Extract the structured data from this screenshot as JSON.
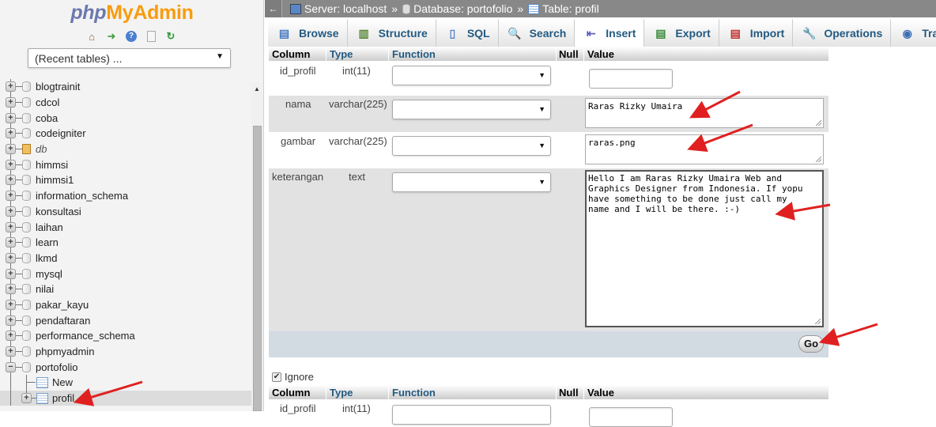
{
  "sidebar": {
    "logo_php": "php",
    "logo_myadmin": "MyAdmin",
    "quick_icons": [
      "home-icon",
      "logout-icon",
      "help-icon",
      "docs-icon",
      "reload-icon"
    ],
    "recent_tables": "(Recent tables) ...",
    "databases": [
      {
        "name": "blogtrainit",
        "icon": "database-icon"
      },
      {
        "name": "cdcol",
        "icon": "database-icon"
      },
      {
        "name": "coba",
        "icon": "database-icon"
      },
      {
        "name": "codeigniter",
        "icon": "database-icon"
      },
      {
        "name": "db",
        "icon": "box-icon"
      },
      {
        "name": "himmsi",
        "icon": "database-icon"
      },
      {
        "name": "himmsi1",
        "icon": "database-icon"
      },
      {
        "name": "information_schema",
        "icon": "database-icon"
      },
      {
        "name": "konsultasi",
        "icon": "database-icon"
      },
      {
        "name": "laihan",
        "icon": "database-icon"
      },
      {
        "name": "learn",
        "icon": "database-icon"
      },
      {
        "name": "lkmd",
        "icon": "database-icon"
      },
      {
        "name": "mysql",
        "icon": "database-icon"
      },
      {
        "name": "nilai",
        "icon": "database-icon"
      },
      {
        "name": "pakar_kayu",
        "icon": "database-icon"
      },
      {
        "name": "pendaftaran",
        "icon": "database-icon"
      },
      {
        "name": "performance_schema",
        "icon": "database-icon"
      },
      {
        "name": "phpmyadmin",
        "icon": "database-icon"
      },
      {
        "name": "portofolio",
        "icon": "database-icon",
        "expanded": true
      }
    ],
    "portofolio_children": [
      "New",
      "profil"
    ]
  },
  "breadcrumb": {
    "back": "←",
    "server": "Server: localhost",
    "database": "Database: portofolio",
    "table": "Table: profil",
    "separator": "»"
  },
  "tabs": [
    {
      "label": "Browse",
      "icon": "browse-icon",
      "glyph": "▤"
    },
    {
      "label": "Structure",
      "icon": "structure-icon",
      "glyph": "▥"
    },
    {
      "label": "SQL",
      "icon": "sql-icon",
      "glyph": "▯"
    },
    {
      "label": "Search",
      "icon": "search-icon",
      "glyph": "🔍"
    },
    {
      "label": "Insert",
      "icon": "insert-icon",
      "glyph": "⇤",
      "active": true
    },
    {
      "label": "Export",
      "icon": "export-icon",
      "glyph": "▤"
    },
    {
      "label": "Import",
      "icon": "import-icon",
      "glyph": "▤"
    },
    {
      "label": "Operations",
      "icon": "wrench-icon",
      "glyph": "🔧"
    },
    {
      "label": "Tracking",
      "icon": "eye-icon",
      "glyph": "◉"
    }
  ],
  "form": {
    "headers": {
      "column": "Column",
      "type": "Type",
      "function": "Function",
      "null": "Null",
      "value": "Value"
    },
    "rows": [
      {
        "column": "id_profil",
        "type": "int(11)",
        "function": "",
        "value": ""
      },
      {
        "column": "nama",
        "type": "varchar(225)",
        "function": "",
        "value": "Raras Rizky Umaira"
      },
      {
        "column": "gambar",
        "type": "varchar(225)",
        "function": "",
        "value": "raras.png"
      },
      {
        "column": "keterangan",
        "type": "text",
        "function": "",
        "value": "Hello I am Raras Rizky Umaira Web and\nGraphics Designer from Indonesia. If yopu\nhave something to be done just call my\nname and I will be there. :-)"
      }
    ],
    "go_label": "Go",
    "ignore_label": "Ignore",
    "ignore_checked": true,
    "second_row": {
      "column": "id_profil",
      "type": "int(11)"
    }
  },
  "colors": {
    "accent_blue": "#235a81",
    "logo_blue": "#6c78af",
    "logo_orange": "#f89c0e",
    "topbar": "#888888",
    "annotation_red": "#e02020"
  }
}
